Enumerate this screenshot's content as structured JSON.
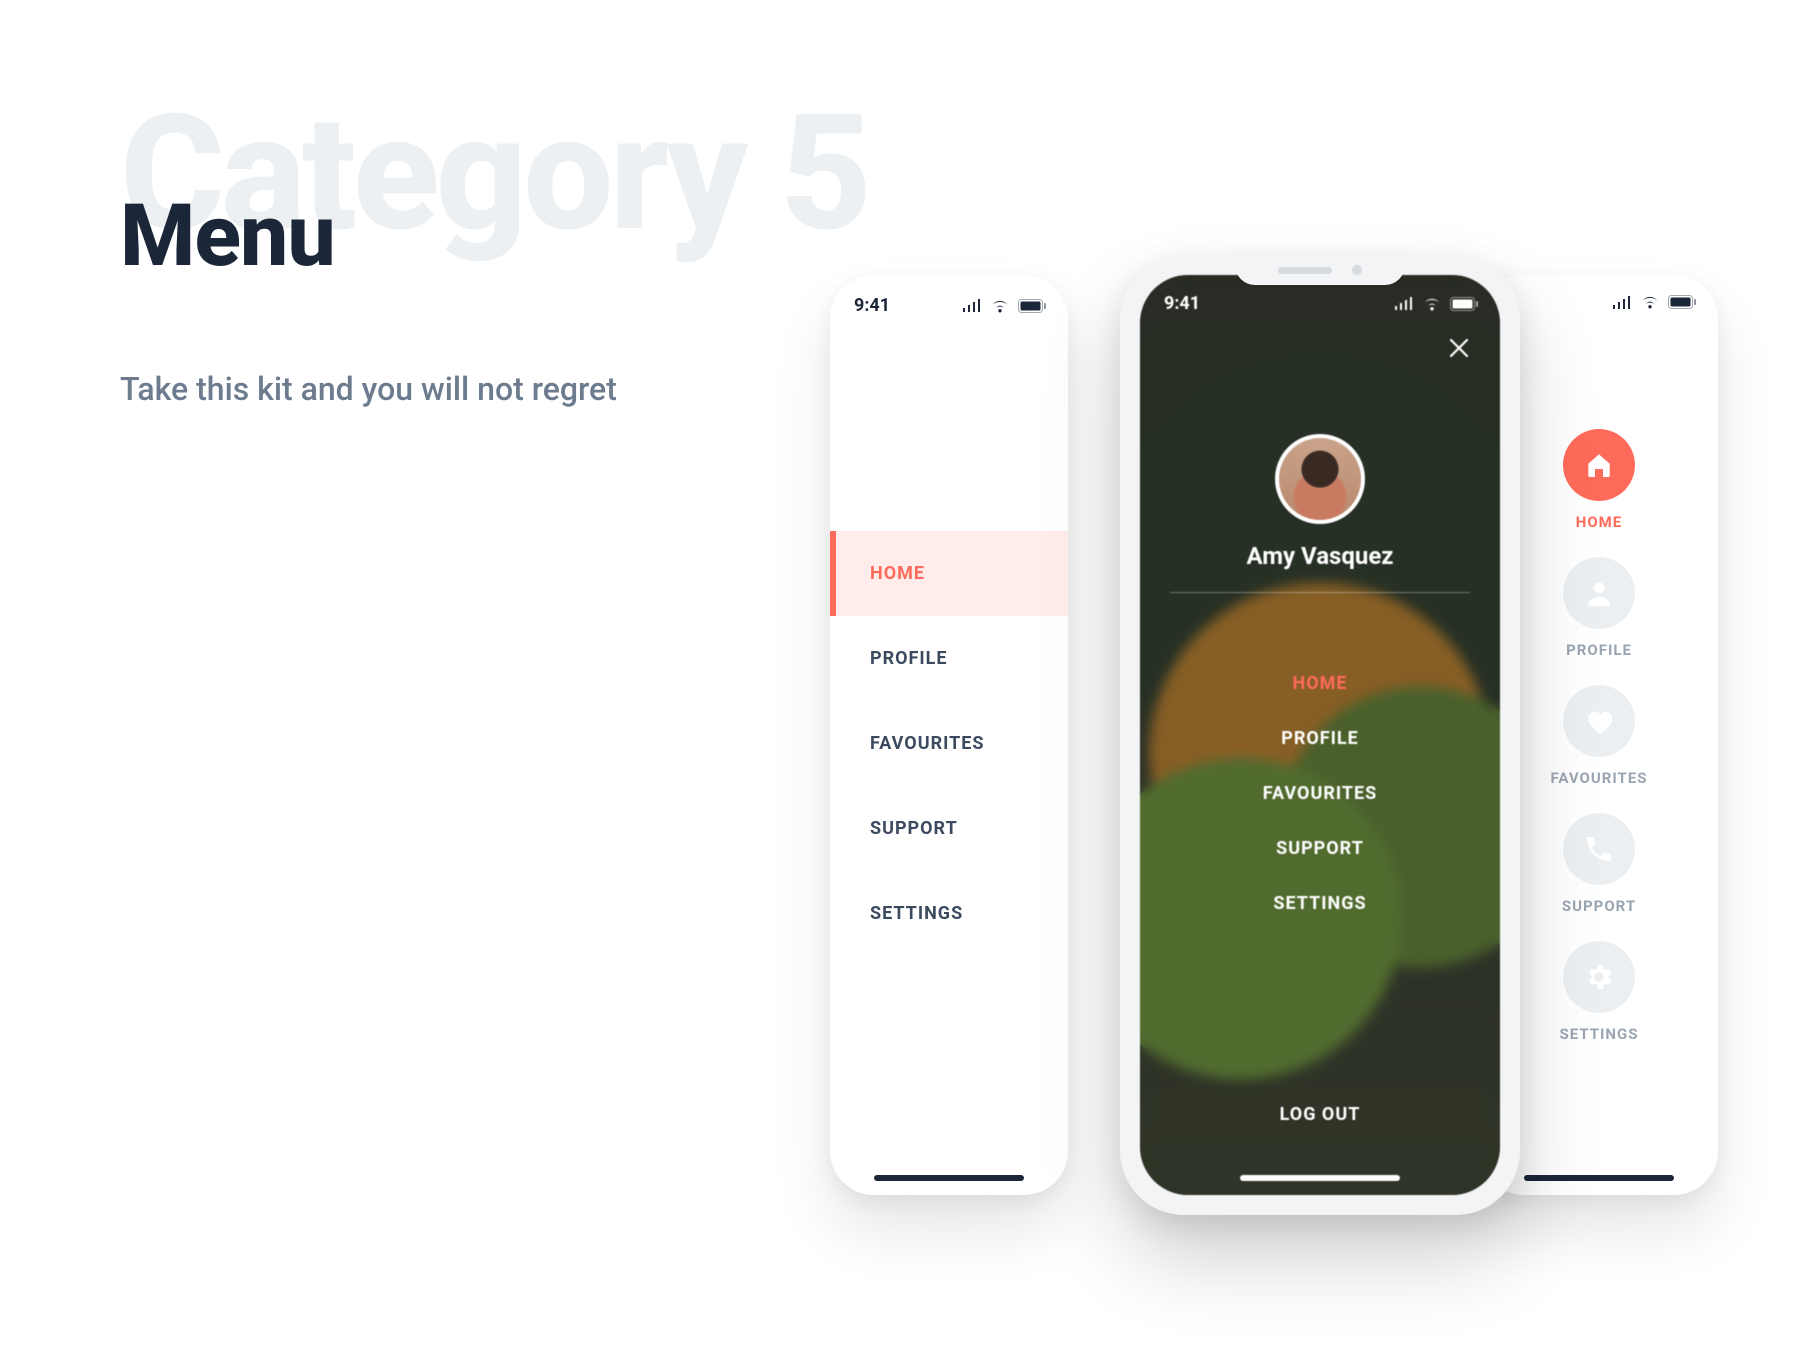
{
  "heading": {
    "background": "Category 5",
    "title": "Menu",
    "subtitle": "Take this kit and you will not regret"
  },
  "status_time": "9:41",
  "left_menu": {
    "items": [
      {
        "label": "HOME",
        "active": true
      },
      {
        "label": "PROFILE",
        "active": false
      },
      {
        "label": "FAVOURITES",
        "active": false
      },
      {
        "label": "SUPPORT",
        "active": false
      },
      {
        "label": "SETTINGS",
        "active": false
      }
    ]
  },
  "center_menu": {
    "user_name": "Amy Vasquez",
    "items": [
      {
        "label": "HOME",
        "active": true
      },
      {
        "label": "PROFILE",
        "active": false
      },
      {
        "label": "FAVOURITES",
        "active": false
      },
      {
        "label": "SUPPORT",
        "active": false
      },
      {
        "label": "SETTINGS",
        "active": false
      }
    ],
    "logout_label": "LOG OUT"
  },
  "right_menu": {
    "items": [
      {
        "label": "HOME",
        "icon": "home",
        "active": true
      },
      {
        "label": "PROFILE",
        "icon": "user",
        "active": false
      },
      {
        "label": "FAVOURITES",
        "icon": "heart",
        "active": false
      },
      {
        "label": "SUPPORT",
        "icon": "phone",
        "active": false
      },
      {
        "label": "SETTINGS",
        "icon": "gear",
        "active": false
      }
    ]
  },
  "colors": {
    "accent": "#ff6b5b",
    "ink": "#1b2639",
    "muted": "#9aa5b1"
  }
}
